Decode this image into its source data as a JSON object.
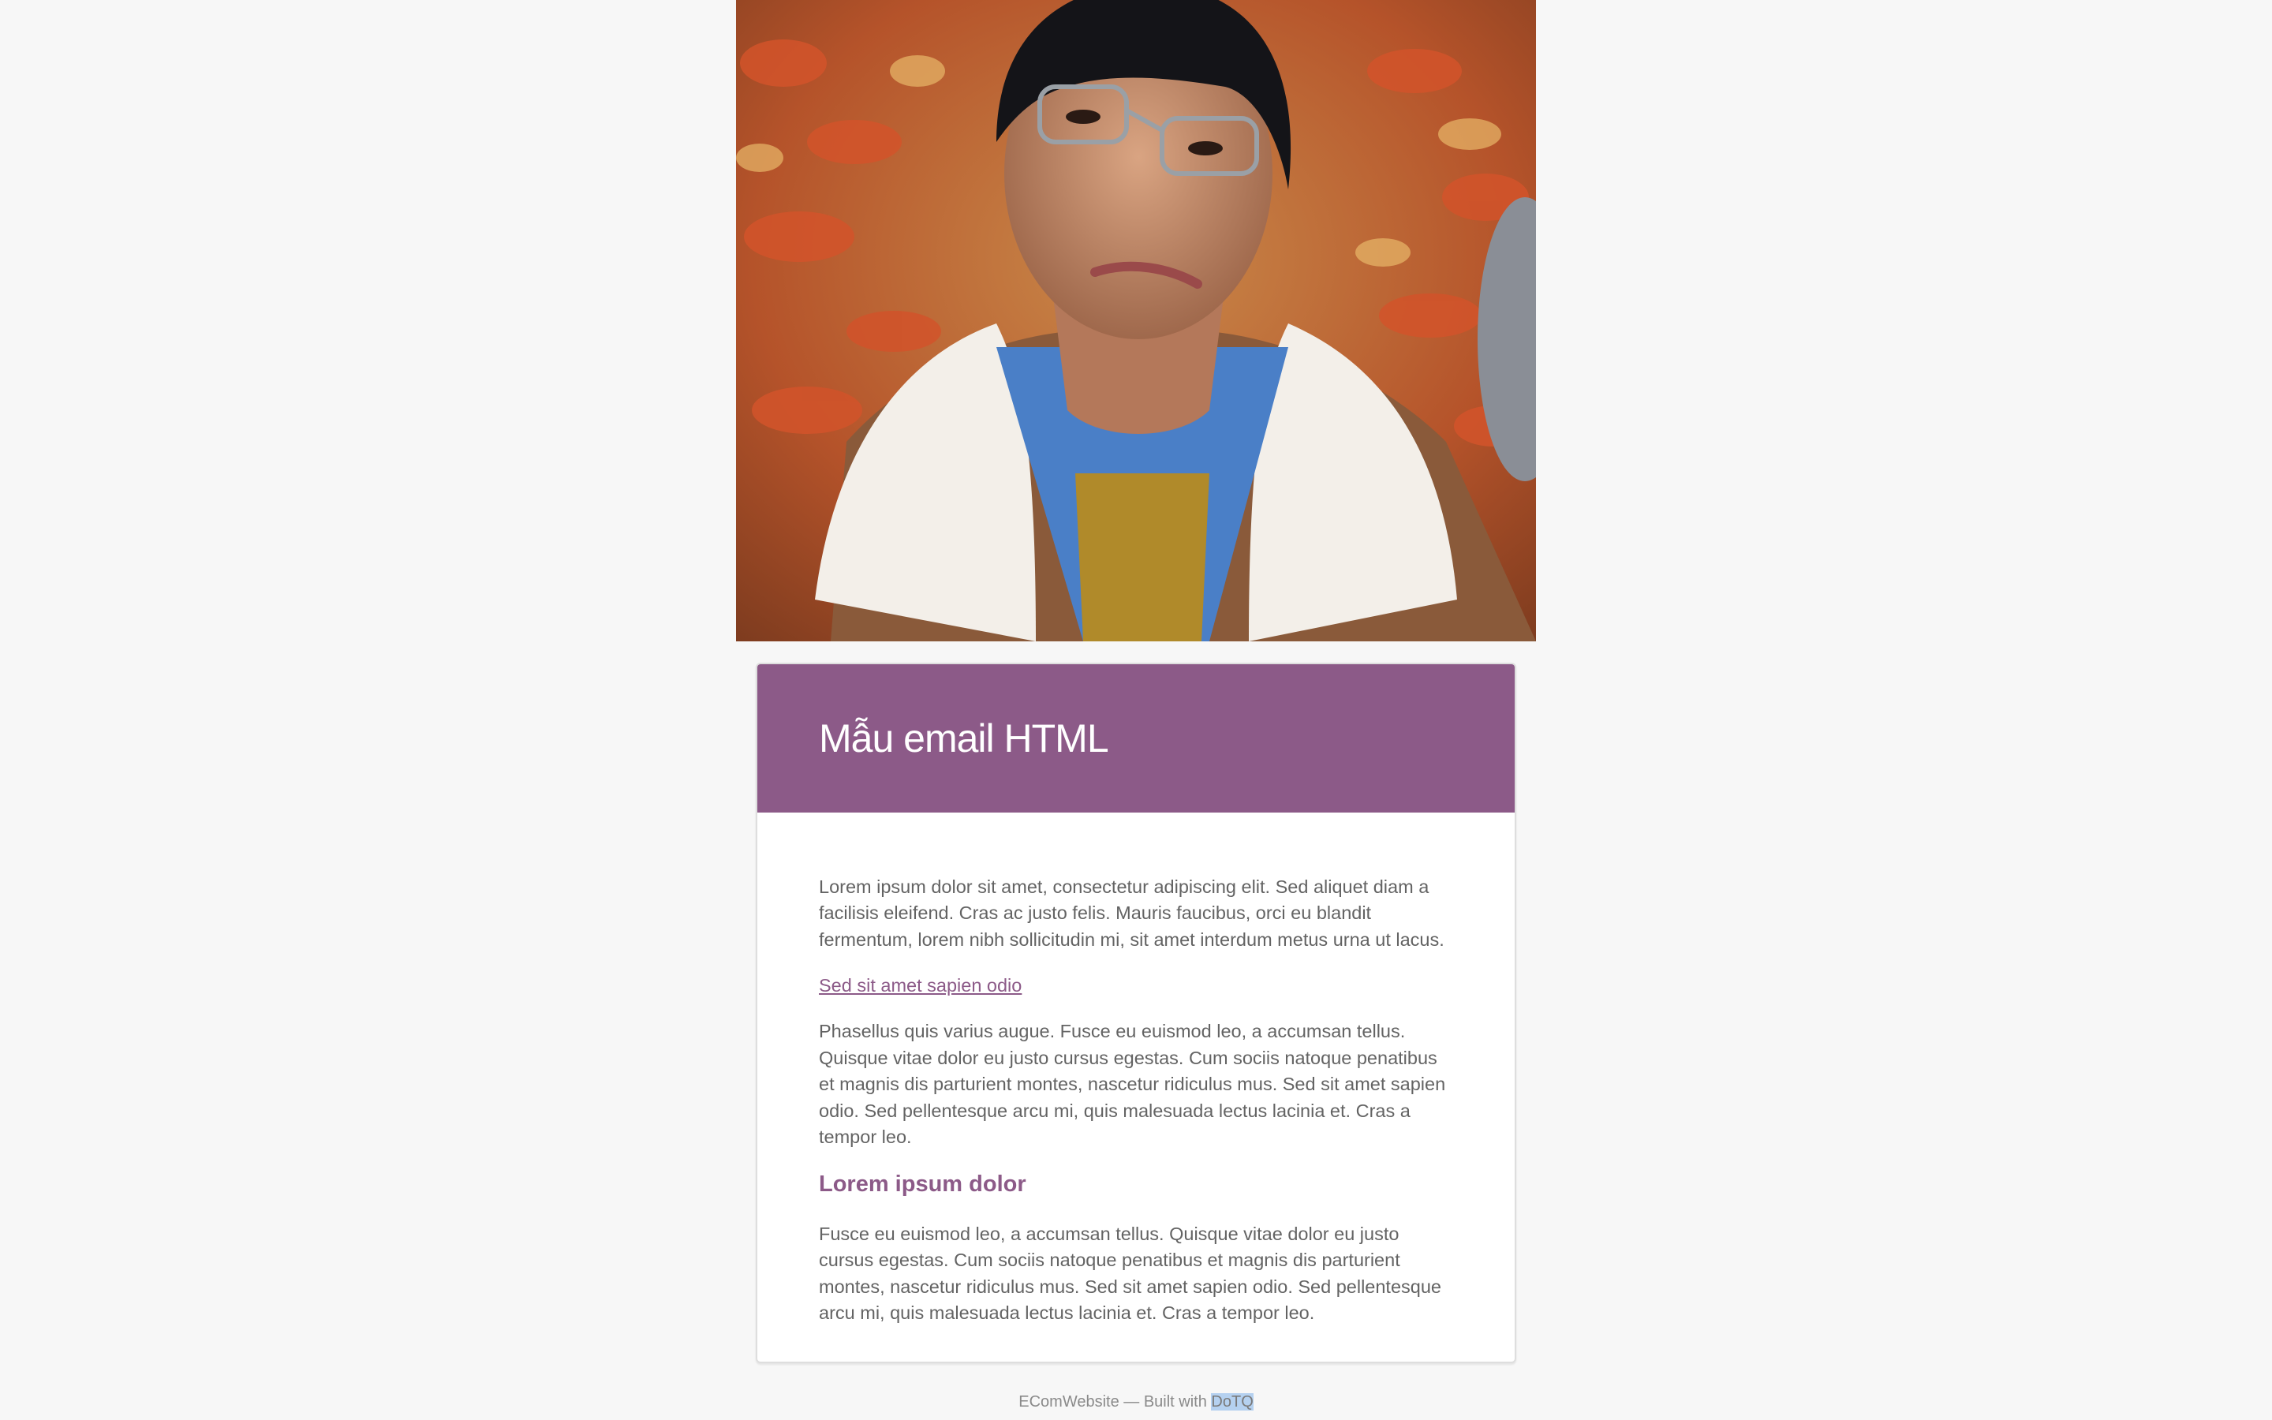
{
  "hero": {
    "image_description": "portrait-photo"
  },
  "email": {
    "title": "Mẫu email HTML",
    "paragraph_1": "Lorem ipsum dolor sit amet, consectetur adipiscing elit. Sed aliquet diam a facilisis eleifend. Cras ac justo felis. Mauris faucibus, orci eu blandit fermentum, lorem nibh sollicitudin mi, sit amet interdum metus urna ut lacus.",
    "link_text": "Sed sit amet sapien odio",
    "paragraph_2": "Phasellus quis varius augue. Fusce eu euismod leo, a accumsan tellus. Quisque vitae dolor eu justo cursus egestas. Cum sociis natoque penatibus et magnis dis parturient montes, nascetur ridiculus mus. Sed sit amet sapien odio. Sed pellentesque arcu mi, quis malesuada lectus lacinia et. Cras a tempor leo.",
    "heading": "Lorem ipsum dolor",
    "paragraph_3": "Fusce eu euismod leo, a accumsan tellus. Quisque vitae dolor eu justo cursus egestas. Cum sociis natoque penatibus et magnis dis parturient montes, nascetur ridiculus mus. Sed sit amet sapien odio. Sed pellentesque arcu mi, quis malesuada lectus lacinia et. Cras a tempor leo."
  },
  "footer": {
    "prefix": "EComWebsite — Built with ",
    "link": "DoTQ"
  },
  "colors": {
    "accent": "#8c5a88",
    "background": "#f7f7f7",
    "text": "#636363"
  }
}
